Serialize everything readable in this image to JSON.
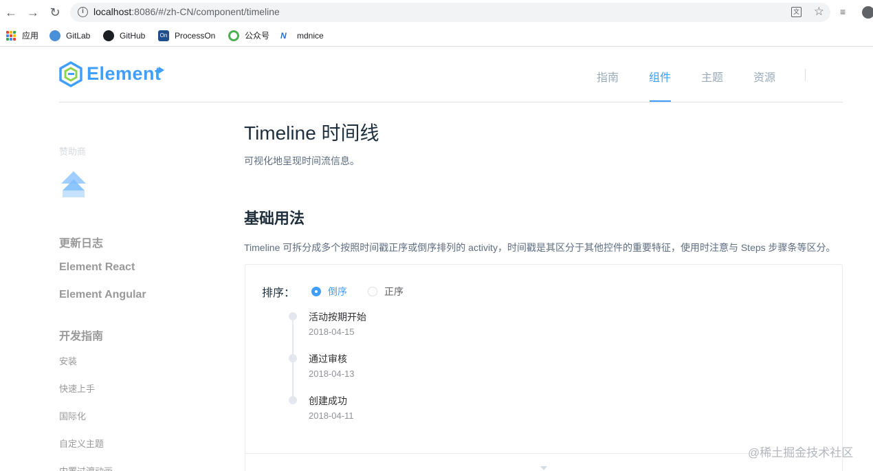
{
  "browser": {
    "url_host": "localhost",
    "url_rest": ":8086/#/zh-CN/component/timeline",
    "bookmarks": [
      {
        "label": "应用",
        "icon": "apps-grid-icon"
      },
      {
        "label": "GitLab",
        "icon": "gitlab-icon"
      },
      {
        "label": "GitHub",
        "icon": "github-icon"
      },
      {
        "label": "ProcessOn",
        "icon": "processon-icon",
        "badge": "On"
      },
      {
        "label": "公众号",
        "icon": "wechat-official-icon"
      },
      {
        "label": "mdnice",
        "icon": "mdnice-icon"
      }
    ]
  },
  "header": {
    "logo_text": "Element",
    "nav": [
      {
        "label": "指南",
        "active": false
      },
      {
        "label": "组件",
        "active": true
      },
      {
        "label": "主题",
        "active": false
      },
      {
        "label": "资源",
        "active": false
      }
    ]
  },
  "sidebar": {
    "sponsor_label": "赞助商",
    "main_links": [
      "更新日志",
      "Element React",
      "Element Angular"
    ],
    "group_title": "开发指南",
    "sub_links": [
      "安装",
      "快速上手",
      "国际化",
      "自定义主题",
      "内置过渡动画"
    ]
  },
  "content": {
    "title": "Timeline 时间线",
    "description": "可视化地呈现时间流信息。",
    "section_title": "基础用法",
    "section_description": "Timeline 可拆分成多个按照时间戳正序或倒序排列的 activity，时间戳是其区分于其他控件的重要特征，使用时注意与 Steps 步骤条等区分。",
    "demo": {
      "sort_label": "排序：",
      "options": [
        {
          "label": "倒序",
          "checked": true
        },
        {
          "label": "正序",
          "checked": false
        }
      ],
      "activities": [
        {
          "content": "活动按期开始",
          "timestamp": "2018-04-15"
        },
        {
          "content": "通过审核",
          "timestamp": "2018-04-13"
        },
        {
          "content": "创建成功",
          "timestamp": "2018-04-11"
        }
      ]
    }
  },
  "watermark": "@稀土掘金技术社区",
  "colors": {
    "primary": "#409eff",
    "text_primary": "#1f2f3d",
    "text_secondary": "#5e6d82",
    "border": "#ebebeb"
  }
}
